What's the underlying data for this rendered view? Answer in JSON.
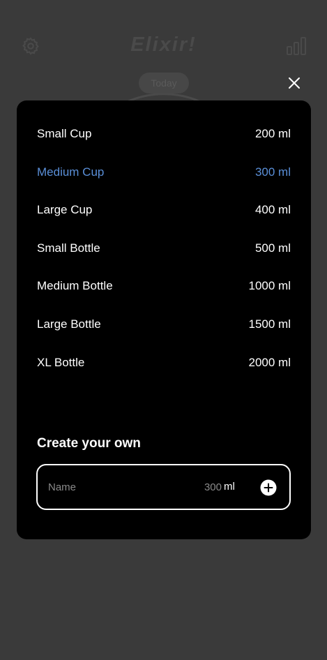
{
  "app": {
    "title": "Elixir!",
    "today_label": "Today"
  },
  "sizes": [
    {
      "label": "Small Cup",
      "amount": "200 ml",
      "selected": false
    },
    {
      "label": "Medium Cup",
      "amount": "300 ml",
      "selected": true
    },
    {
      "label": "Large Cup",
      "amount": "400 ml",
      "selected": false
    },
    {
      "label": "Small Bottle",
      "amount": "500 ml",
      "selected": false
    },
    {
      "label": "Medium Bottle",
      "amount": "1000 ml",
      "selected": false
    },
    {
      "label": "Large Bottle",
      "amount": "1500 ml",
      "selected": false
    },
    {
      "label": "XL Bottle",
      "amount": "2000 ml",
      "selected": false
    }
  ],
  "create": {
    "title": "Create your own",
    "name_placeholder": "Name",
    "amount_value": "300",
    "unit": "ml"
  },
  "colors": {
    "accent": "#5a8fd8",
    "modal_bg": "#000000",
    "backdrop": "#3a3a3a"
  }
}
